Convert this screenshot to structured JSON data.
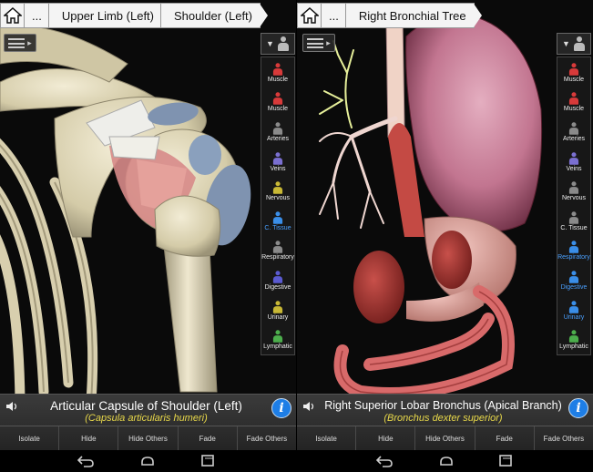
{
  "left": {
    "breadcrumb": {
      "more": "...",
      "items": [
        "Upper Limb (Left)",
        "Shoulder (Left)"
      ]
    },
    "info": {
      "title": "Articular Capsule of Shoulder (Left)",
      "latin": "(Capsula articularis humeri)"
    }
  },
  "right": {
    "breadcrumb": {
      "more": "...",
      "items": [
        "Right Bronchial Tree"
      ]
    },
    "info": {
      "title": "Right Superior Lobar Bronchus (Apical Branch)",
      "latin": "(Bronchus dexter superior)"
    }
  },
  "actions": {
    "isolate": "Isolate",
    "hide": "Hide",
    "hide_others": "Hide Others",
    "fade": "Fade",
    "fade_others": "Fade Others"
  },
  "info_button": "i",
  "systems_left": [
    {
      "label": "Muscle",
      "color": "#d83a3a",
      "mark": "+"
    },
    {
      "label": "Muscle",
      "color": "#d83a3a",
      "mark": "-"
    },
    {
      "label": "Arteries",
      "color": "#8a8a8a"
    },
    {
      "label": "Veins",
      "color": "#7a6fd0"
    },
    {
      "label": "Nervous",
      "color": "#c8b835"
    },
    {
      "label": "C. Tissue",
      "color": "#3a8ee8",
      "active": true
    },
    {
      "label": "Respiratory",
      "color": "#8a8a8a"
    },
    {
      "label": "Digestive",
      "color": "#5a5ad0"
    },
    {
      "label": "Urinary",
      "color": "#c8b835"
    },
    {
      "label": "Lymphatic",
      "color": "#4cae4c"
    }
  ],
  "systems_right": [
    {
      "label": "Muscle",
      "color": "#d83a3a",
      "mark": "+"
    },
    {
      "label": "Muscle",
      "color": "#d83a3a",
      "mark": "-"
    },
    {
      "label": "Arteries",
      "color": "#8a8a8a"
    },
    {
      "label": "Veins",
      "color": "#7a6fd0"
    },
    {
      "label": "Nervous",
      "color": "#8a8a8a"
    },
    {
      "label": "C. Tissue",
      "color": "#8a8a8a"
    },
    {
      "label": "Respiratory",
      "color": "#3a8ee8",
      "active": true
    },
    {
      "label": "Digestive",
      "color": "#3a8ee8",
      "active": true
    },
    {
      "label": "Urinary",
      "color": "#3a8ee8",
      "active": true
    },
    {
      "label": "Lymphatic",
      "color": "#4cae4c"
    }
  ],
  "colors": {
    "accent": "#1e7ee6",
    "latin_text": "#e8d84a",
    "active_system": "#4aa0ff"
  },
  "icons": {
    "home": "home-icon",
    "list": "list-icon",
    "speaker": "speaker-icon",
    "info": "info-icon",
    "back": "back-icon",
    "home_nav": "home-nav-icon",
    "recents": "recents-icon"
  }
}
